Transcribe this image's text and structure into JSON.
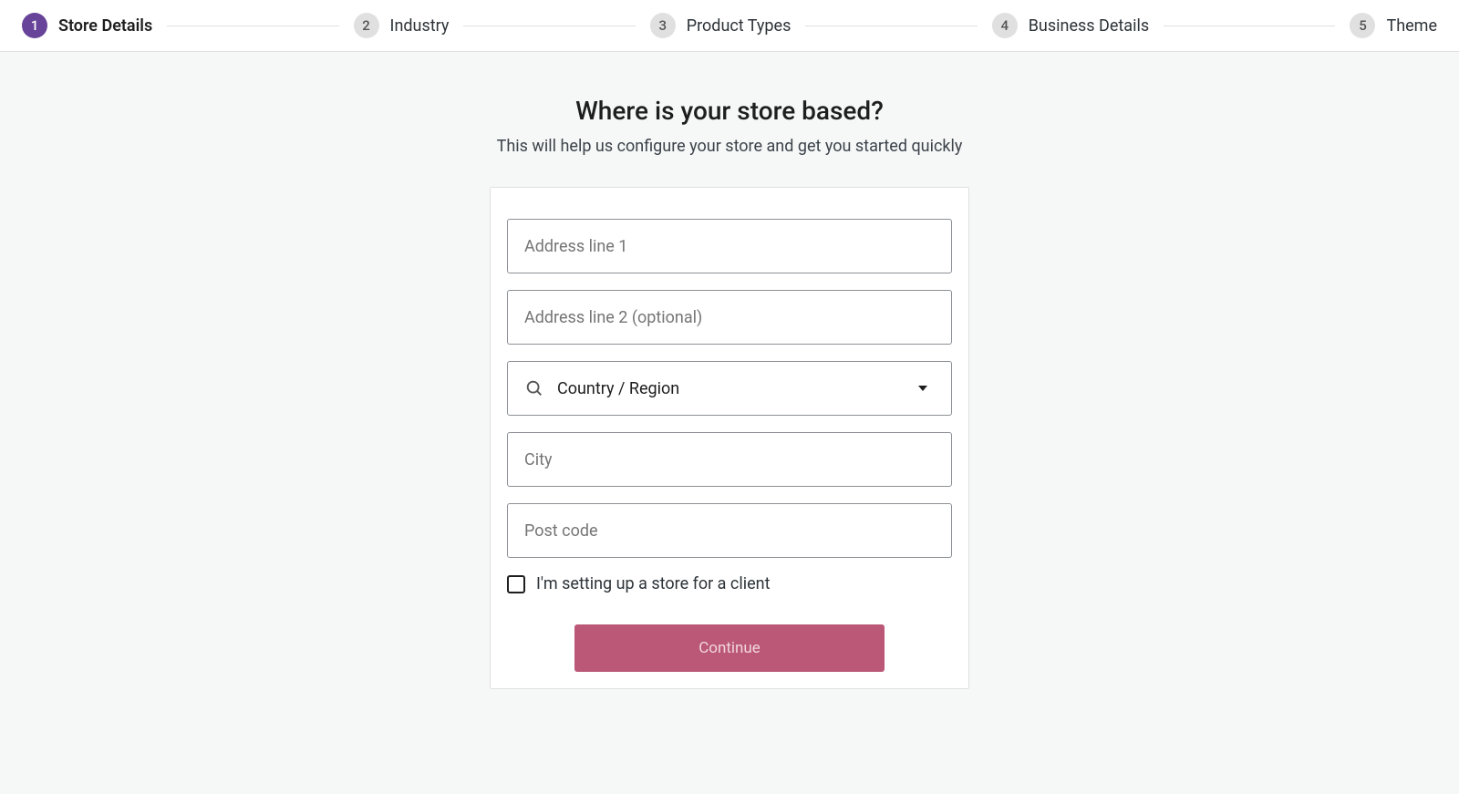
{
  "stepper": {
    "steps": [
      {
        "number": "1",
        "label": "Store Details",
        "active": true
      },
      {
        "number": "2",
        "label": "Industry",
        "active": false
      },
      {
        "number": "3",
        "label": "Product Types",
        "active": false
      },
      {
        "number": "4",
        "label": "Business Details",
        "active": false
      },
      {
        "number": "5",
        "label": "Theme",
        "active": false
      }
    ]
  },
  "heading": {
    "title": "Where is your store based?",
    "subtitle": "This will help us configure your store and get you started quickly"
  },
  "form": {
    "address1_placeholder": "Address line 1",
    "address2_placeholder": "Address line 2 (optional)",
    "country_placeholder": "Country / Region",
    "city_placeholder": "City",
    "postcode_placeholder": "Post code",
    "client_checkbox_label": "I'm setting up a store for a client",
    "continue_label": "Continue"
  }
}
